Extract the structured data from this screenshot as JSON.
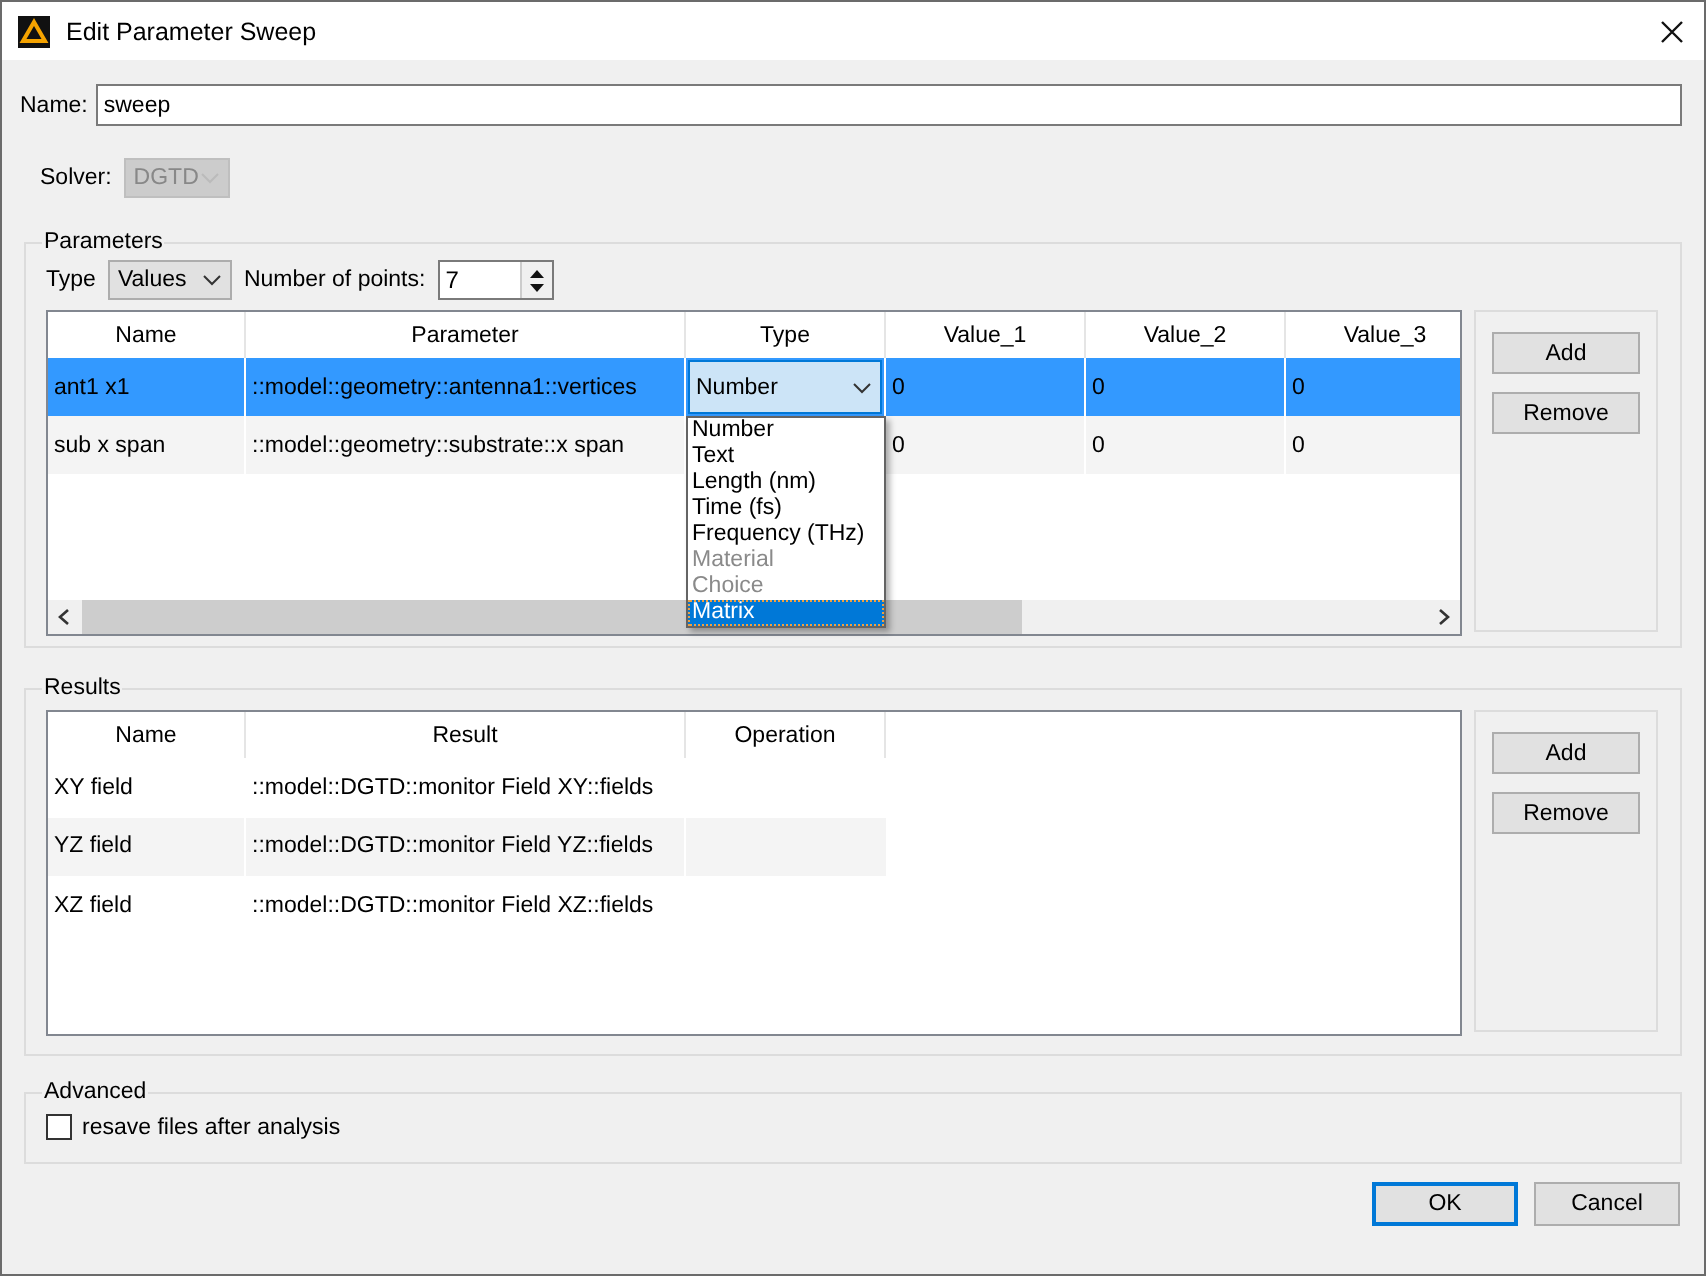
{
  "window": {
    "title": "Edit Parameter Sweep"
  },
  "name_field": {
    "label": "Name:",
    "value": "sweep"
  },
  "solver": {
    "label": "Solver:",
    "value": "DGTD",
    "disabled": true
  },
  "parameters": {
    "title": "Parameters",
    "type_label": "Type",
    "type_value": "Values",
    "points_label": "Number of points:",
    "points_value": "7",
    "columns": [
      "Name",
      "Parameter",
      "Type",
      "Value_1",
      "Value_2",
      "Value_3"
    ],
    "rows": [
      {
        "name": "ant1 x1",
        "parameter": "::model::geometry::antenna1::vertices",
        "type": "Number",
        "values": [
          "0",
          "0",
          "0"
        ],
        "selected": true
      },
      {
        "name": "sub x span",
        "parameter": "::model::geometry::substrate::x span",
        "values": [
          "0",
          "0",
          "0"
        ],
        "selected": false
      }
    ],
    "type_options": [
      {
        "label": "Number",
        "disabled": false,
        "selected": false
      },
      {
        "label": "Text",
        "disabled": false,
        "selected": false
      },
      {
        "label": "Length (nm)",
        "disabled": false,
        "selected": false
      },
      {
        "label": "Time (fs)",
        "disabled": false,
        "selected": false
      },
      {
        "label": "Frequency (THz)",
        "disabled": false,
        "selected": false
      },
      {
        "label": "Material",
        "disabled": true,
        "selected": false
      },
      {
        "label": "Choice",
        "disabled": true,
        "selected": false
      },
      {
        "label": "Matrix",
        "disabled": false,
        "selected": true
      }
    ],
    "buttons": [
      "Add",
      "Remove"
    ]
  },
  "results": {
    "title": "Results",
    "columns": [
      "Name",
      "Result",
      "Operation"
    ],
    "rows": [
      {
        "name": "XY field",
        "result": "::model::DGTD::monitor Field XY::fields"
      },
      {
        "name": "YZ field",
        "result": "::model::DGTD::monitor Field YZ::fields"
      },
      {
        "name": "XZ field",
        "result": "::model::DGTD::monitor Field XZ::fields"
      }
    ],
    "buttons": [
      "Add",
      "Remove"
    ]
  },
  "advanced": {
    "title": "Advanced",
    "checkbox": {
      "label": "resave files after analysis",
      "checked": false
    }
  },
  "buttons": [
    {
      "label": "OK",
      "default": true
    },
    {
      "label": "Cancel",
      "default": false
    }
  ]
}
